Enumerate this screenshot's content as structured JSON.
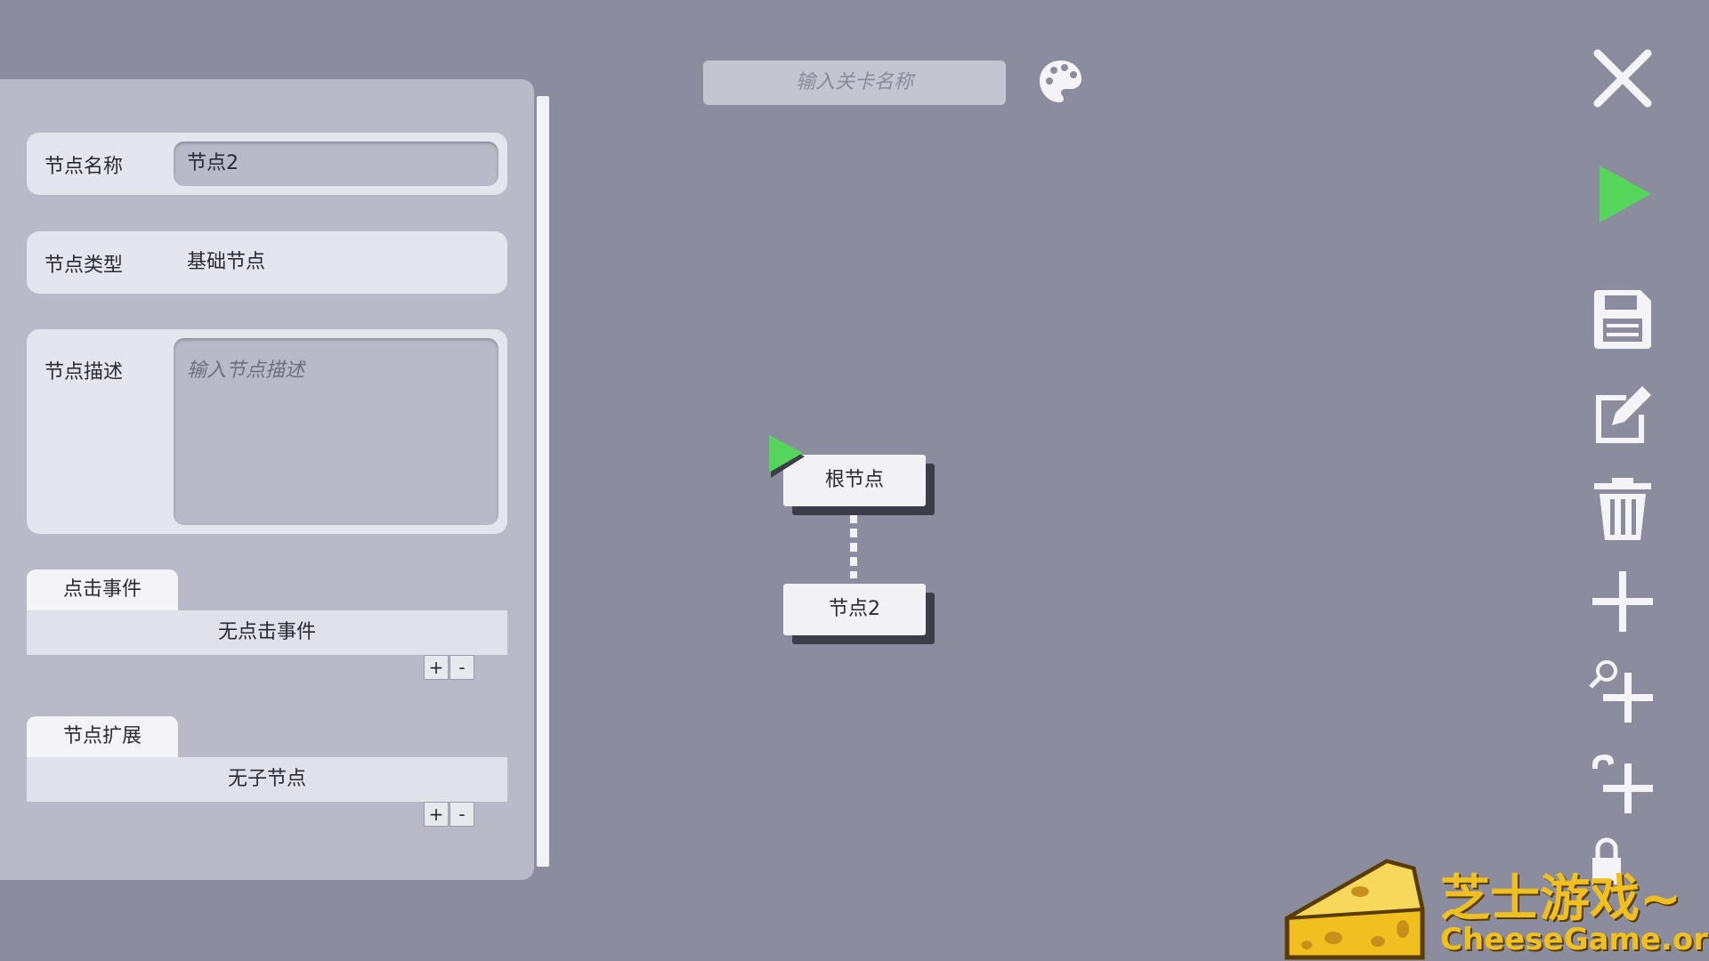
{
  "colors": {
    "background": "#8c8c9f",
    "panel": "#b9b9c7",
    "accent_green": "#55d65a",
    "watermark_yellow": "#f0c020"
  },
  "level": {
    "name_placeholder": "输入关卡名称"
  },
  "inspector": {
    "node_name_label": "节点名称",
    "node_name_value": "节点2",
    "node_type_label": "节点类型",
    "node_type_value": "基础节点",
    "node_desc_label": "节点描述",
    "node_desc_placeholder": "输入节点描述",
    "click_events_tab": "点击事件",
    "click_events_empty": "无点击事件",
    "extensions_tab": "节点扩展",
    "extensions_empty": "无子节点",
    "add_label": "+",
    "remove_label": "-"
  },
  "graph": {
    "root_node_label": "根节点",
    "child_node_label": "节点2"
  },
  "toolbar": {
    "icons": [
      "close-icon",
      "play-icon",
      "save-icon",
      "edit-icon",
      "trash-icon",
      "add-icon",
      "search-add-icon",
      "hand-add-icon",
      "lock-icon"
    ]
  },
  "watermark": {
    "cn": "芝士游戏~",
    "en": "CheeseGame.org"
  }
}
